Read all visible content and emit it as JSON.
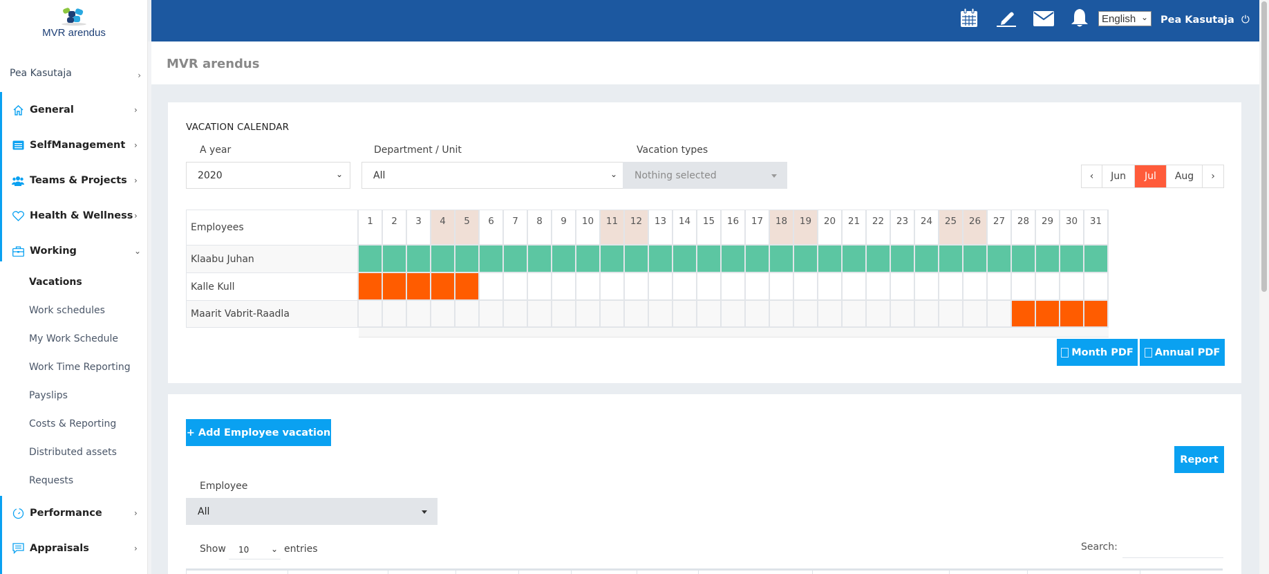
{
  "app": {
    "logo_text": "MVR arendus",
    "page_title": "MVR arendus"
  },
  "topbar": {
    "icons": [
      "calendar-icon",
      "pen-icon",
      "envelope-icon",
      "bell-icon"
    ],
    "language": "English",
    "user_name": "Pea Kasutaja",
    "power_icon": "⏻"
  },
  "sidebar": {
    "user": "Pea Kasutaja",
    "items": [
      {
        "label": "General",
        "icon": "home-icon",
        "expanded": false
      },
      {
        "label": "SelfManagement",
        "icon": "id-card-icon",
        "expanded": false
      },
      {
        "label": "Teams & Projects",
        "icon": "users-icon",
        "expanded": false
      },
      {
        "label": "Health & Wellness",
        "icon": "heart-icon",
        "expanded": false
      },
      {
        "label": "Working",
        "icon": "briefcase-icon",
        "expanded": true
      },
      {
        "label": "Performance",
        "icon": "speedometer-icon",
        "expanded": false
      },
      {
        "label": "Appraisals",
        "icon": "comment-icon",
        "expanded": false
      }
    ],
    "working_subitems": [
      {
        "label": "Vacations",
        "active": true
      },
      {
        "label": "Work schedules",
        "active": false
      },
      {
        "label": "My Work Schedule",
        "active": false
      },
      {
        "label": "Work Time Reporting",
        "active": false
      },
      {
        "label": "Payslips",
        "active": false
      },
      {
        "label": "Costs & Reporting",
        "active": false
      },
      {
        "label": "Distributed assets",
        "active": false
      },
      {
        "label": "Requests",
        "active": false
      }
    ]
  },
  "calendar": {
    "section_title": "VACATION CALENDAR",
    "filters": {
      "year_label": "A year",
      "year_value": "2020",
      "department_label": "Department / Unit",
      "department_value": "All",
      "vacation_types_label": "Vacation types",
      "vacation_types_value": "Nothing selected"
    },
    "month_nav": {
      "prev": "‹",
      "months": [
        "Jun",
        "Jul",
        "Aug"
      ],
      "active_month": "Jul",
      "next": "›"
    },
    "employees_header": "Employees",
    "days": [
      1,
      2,
      3,
      4,
      5,
      6,
      7,
      8,
      9,
      10,
      11,
      12,
      13,
      14,
      15,
      16,
      17,
      18,
      19,
      20,
      21,
      22,
      23,
      24,
      25,
      26,
      27,
      28,
      29,
      30,
      31
    ],
    "weekend_days": [
      4,
      5,
      11,
      12,
      18,
      19,
      25,
      26
    ],
    "rows": [
      {
        "name": "Klaabu Juhan",
        "vacation_days": [
          1,
          2,
          3,
          4,
          5,
          6,
          7,
          8,
          9,
          10,
          11,
          12,
          13,
          14,
          15,
          16,
          17,
          18,
          19,
          20,
          21,
          22,
          23,
          24,
          25,
          26,
          27,
          28,
          29,
          30,
          31
        ],
        "color": "#5cc6a2"
      },
      {
        "name": "Kalle Kull",
        "vacation_days": [
          1,
          2,
          3,
          4,
          5
        ],
        "color": "#ff5c00"
      },
      {
        "name": "Maarit Vabrit-Raadla",
        "vacation_days": [
          28,
          29,
          30,
          31
        ],
        "color": "#ff5c00"
      }
    ],
    "month_pdf_label": "Month PDF",
    "annual_pdf_label": "Annual PDF"
  },
  "vacations_list": {
    "add_button_label": "+ Add Employee vacation",
    "report_button_label": "Report",
    "employee_filter_label": "Employee",
    "employee_filter_value": "All",
    "show_label": "Show",
    "entries_value": "10",
    "entries_label": "entries",
    "search_label": "Search:",
    "search_value": ""
  }
}
